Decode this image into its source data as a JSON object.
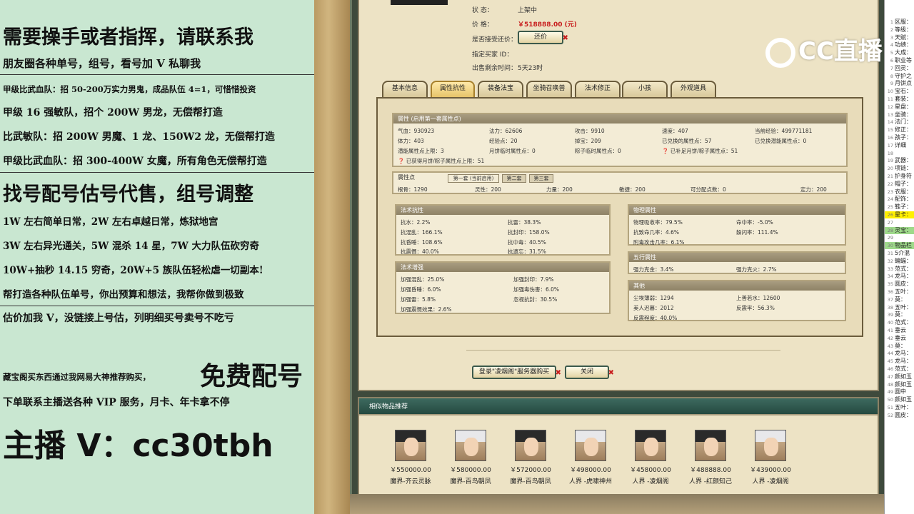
{
  "promo": {
    "line1": "需要操手或者指挥，请联系我",
    "line2": "朋友圈各种单号，组号，看号加 V 私聊我",
    "line3": "甲级比武血队：招 50-200万实力男鬼，成品队伍 4=1，可惜惜投资",
    "line4": "甲级 16 强敏队，招个 200W 男龙，无偿帮打造",
    "line5": "比武敏队：招 200W 男魔、1 龙、150W2 龙，无偿帮打造",
    "line6": "甲级比武血队：招 300-400W 女魔，所有角色无偿帮打造",
    "line7": "找号配号估号代售，组号调整",
    "line8": "1W 左右简单日常，2W 左右卓越日常，炼狱地宫",
    "line9": "3W 左右异光通关，5W 混杀 14 星，7W 大力队伍砍穷奇",
    "line10": "10W+抽秒 14.15 穷奇，20W+5 族队伍轻松虐一切副本!",
    "line11": "帮打造各种队伍单号，你出预算和想法，我帮你做到极致",
    "line12": "估价加我 V，没链接上号估，列明细买号卖号不吃亏",
    "line13a": "藏宝阁买东西通过我网易大神推荐购买，",
    "line13b": "免费配号",
    "line14": "下单联系主播送各种 VIP 服务，月卡、年卡拿不停",
    "line15": "主播 V：cc30tbh"
  },
  "listing": {
    "status_label": "状        态：",
    "status_value": "上架中",
    "price_label": "价        格：",
    "price_value": "￥518888.00 (元)",
    "bargain_label": "是否接受还价：",
    "bargain_button": "还价",
    "buyer_label": "指定买家 ID：",
    "remaining_label": "出售剩余时间：",
    "remaining_value": "5天23时"
  },
  "tabs": [
    "基本信息",
    "属性抗性",
    "装备法宝",
    "坐骑召唤兽",
    "法术修正",
    "小孩",
    "外观道具"
  ],
  "attr": {
    "header": "属性 (启用第一套属性点)",
    "rows": [
      [
        "气血：930923",
        "法力：62606",
        "攻击：9910",
        "速度：407",
        "当前经验：499771181"
      ],
      [
        "体力：403",
        "经验点：20",
        "掉宝：209",
        "已兑换的属性点：57",
        "已兑换潜能属性点：0"
      ],
      [
        "潜能属性点上限：3",
        "月饼临时属性点：0",
        "粽子临时属性点：0",
        "已补足月饼/粽子属性点：51",
        ""
      ],
      [
        "已获得月饼/粽子属性点上限：51",
        "",
        "",
        "",
        ""
      ]
    ]
  },
  "points": {
    "header": "属性点",
    "subtabs": [
      "第一套 (当前启用)",
      "第二套",
      "第三套"
    ],
    "values": [
      "根骨：1290",
      "灵性：200",
      "力量：200",
      "敏捷：200",
      "可分配点数：0",
      "定力：200"
    ]
  },
  "spell_res": {
    "header": "法术抗性",
    "cells": [
      "抗水：2.2%",
      "抗雷：38.3%",
      "抗混乱：166.1%",
      "抗封印：158.0%",
      "抗昏睡：108.6%",
      "抗中毒：40.5%",
      "抗震慑：40.0%",
      "抗遗忘：31.5%"
    ]
  },
  "spell_boost": {
    "header": "法术增强",
    "cells": [
      "加强混乱：25.0%",
      "加强封印：7.9%",
      "加强昏睡：6.0%",
      "加强毒伤害：6.0%",
      "加强雷：5.8%",
      "忽视抗封：30.5%",
      "加强震慑效果：2.6%",
      ""
    ]
  },
  "phys": {
    "header": "物理属性",
    "cells": [
      "物理吸收率：79.5%",
      "命中率：-5.0%",
      "抗致命几率：4.6%",
      "躲闪率：111.4%",
      "附毒攻击几率：6.1%",
      ""
    ]
  },
  "five": {
    "header": "五行属性",
    "cells": [
      "强力克金：3.4%",
      "强力克火：2.7%"
    ]
  },
  "other": {
    "header": "其他",
    "cells": [
      "尘埃薄弱：1294",
      "上善若水：12600",
      "美人迟暮：2012",
      "反震率：56.3%",
      "反震程度：40.0%",
      ""
    ]
  },
  "actions": {
    "login_button": "登录\"凌烟阁\"服务器购买",
    "close_button": "关闭"
  },
  "similar": {
    "header": "相似物品推荐",
    "items": [
      {
        "price": "￥550000.00",
        "name": "魔界-齐云灵脉",
        "hair": "dark"
      },
      {
        "price": "￥580000.00",
        "name": "魔界-百鸟朝凤",
        "hair": "white"
      },
      {
        "price": "￥572000.00",
        "name": "魔界-百鸟朝凤",
        "hair": "dark"
      },
      {
        "price": "￥498000.00",
        "name": "人界 -虎啸神州",
        "hair": "white"
      },
      {
        "price": "￥458000.00",
        "name": "人界 -凌烟阁",
        "hair": "dark"
      },
      {
        "price": "￥488888.00",
        "name": "人界 -红颜知己",
        "hair": "dark"
      },
      {
        "price": "￥439000.00",
        "name": "人界 -凌烟阁",
        "hair": "white"
      }
    ]
  },
  "watermark": {
    "text": "CC直播"
  },
  "sheet": {
    "rows": [
      {
        "n": "1",
        "t": "区服：",
        "c": ""
      },
      {
        "n": "2",
        "t": "等级：",
        "c": ""
      },
      {
        "n": "3",
        "t": "天赋：",
        "c": ""
      },
      {
        "n": "4",
        "t": "功绩：",
        "c": ""
      },
      {
        "n": "5",
        "t": "大成：",
        "c": ""
      },
      {
        "n": "6",
        "t": "职业等",
        "c": ""
      },
      {
        "n": "7",
        "t": "回灵：",
        "c": ""
      },
      {
        "n": "8",
        "t": "守护之",
        "c": ""
      },
      {
        "n": "9",
        "t": "月饼点",
        "c": ""
      },
      {
        "n": "10",
        "t": "宝石：",
        "c": ""
      },
      {
        "n": "11",
        "t": "套装：",
        "c": ""
      },
      {
        "n": "12",
        "t": "星盘：",
        "c": ""
      },
      {
        "n": "13",
        "t": "坐骑：",
        "c": ""
      },
      {
        "n": "14",
        "t": "法门：",
        "c": ""
      },
      {
        "n": "15",
        "t": "修正：",
        "c": ""
      },
      {
        "n": "16",
        "t": "孩子：",
        "c": ""
      },
      {
        "n": "17",
        "t": "详细",
        "c": ""
      },
      {
        "n": "18",
        "t": "",
        "c": ""
      },
      {
        "n": "19",
        "t": "武器：",
        "c": ""
      },
      {
        "n": "20",
        "t": "项链：",
        "c": ""
      },
      {
        "n": "21",
        "t": "护身符",
        "c": ""
      },
      {
        "n": "22",
        "t": "帽子：",
        "c": ""
      },
      {
        "n": "23",
        "t": "衣服：",
        "c": ""
      },
      {
        "n": "24",
        "t": "配饰：",
        "c": ""
      },
      {
        "n": "25",
        "t": "鞋子：",
        "c": ""
      },
      {
        "n": "26",
        "t": "星卡：",
        "c": "yl"
      },
      {
        "n": "27",
        "t": "",
        "c": ""
      },
      {
        "n": "28",
        "t": "灵宝：",
        "c": "gr"
      },
      {
        "n": "29",
        "t": "",
        "c": ""
      },
      {
        "n": "30",
        "t": "物品栏",
        "c": "gr"
      },
      {
        "n": "31",
        "t": "5介混",
        "c": ""
      },
      {
        "n": "32",
        "t": "蝙蝠：",
        "c": ""
      },
      {
        "n": "33",
        "t": "范式：",
        "c": ""
      },
      {
        "n": "34",
        "t": "龙马：",
        "c": ""
      },
      {
        "n": "35",
        "t": "圆皮：",
        "c": ""
      },
      {
        "n": "36",
        "t": "五叶：",
        "c": ""
      },
      {
        "n": "37",
        "t": "莫：",
        "c": ""
      },
      {
        "n": "38",
        "t": "五叶：",
        "c": ""
      },
      {
        "n": "39",
        "t": "莫：",
        "c": ""
      },
      {
        "n": "40",
        "t": "范式：",
        "c": ""
      },
      {
        "n": "41",
        "t": "垂云",
        "c": ""
      },
      {
        "n": "42",
        "t": "垂云",
        "c": ""
      },
      {
        "n": "43",
        "t": "莫：",
        "c": ""
      },
      {
        "n": "44",
        "t": "龙马：",
        "c": ""
      },
      {
        "n": "45",
        "t": "龙马：",
        "c": ""
      },
      {
        "n": "46",
        "t": "范式：",
        "c": ""
      },
      {
        "n": "47",
        "t": "颜如玉",
        "c": ""
      },
      {
        "n": "48",
        "t": "颜如玉",
        "c": ""
      },
      {
        "n": "49",
        "t": "圆中",
        "c": ""
      },
      {
        "n": "50",
        "t": "颜如玉",
        "c": ""
      },
      {
        "n": "51",
        "t": "五叶：",
        "c": ""
      },
      {
        "n": "52",
        "t": "圆皮：",
        "c": ""
      }
    ]
  }
}
